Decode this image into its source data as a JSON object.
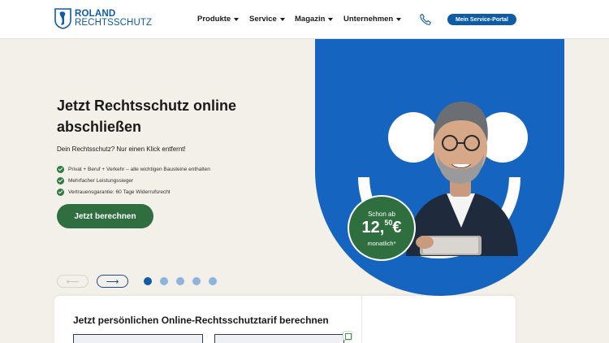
{
  "brand": {
    "line1": "ROLAND",
    "line2": "RECHTSSCHUTZ",
    "color": "#0e5ba6"
  },
  "nav": {
    "items": [
      {
        "label": "Produkte"
      },
      {
        "label": "Service"
      },
      {
        "label": "Magazin"
      },
      {
        "label": "Unternehmen"
      }
    ],
    "phone_icon": "phone-icon",
    "portal_label": "Mein Service-Portal"
  },
  "hero": {
    "title": "Jetzt Rechtsschutz online abschließen",
    "subtitle": "Dein Rechtsschutz? Nur einen Klick entfernt!",
    "features": [
      "Privat + Beruf + Verkehr – alle wichtigen Bausteine enthalten",
      "Mehrfacher Leistungssieger",
      "Vertrauensgarantie: 60 Tage Widerrufsrecht"
    ],
    "cta_label": "Jetzt berechnen",
    "accent_green": "#2f6e3e",
    "accent_blue": "#1565c0"
  },
  "slider": {
    "prev_symbol": "⟵",
    "next_symbol": "⟶",
    "slide_count": 5,
    "active_index": 0
  },
  "price_badge": {
    "prefix": "Schon ab",
    "amount_main": "12,",
    "amount_cents": "50",
    "currency": "€",
    "suffix": "monatlich*"
  },
  "calculator": {
    "title": "Jetzt persönlichen Online-Rechtsschutztarif berechnen"
  }
}
